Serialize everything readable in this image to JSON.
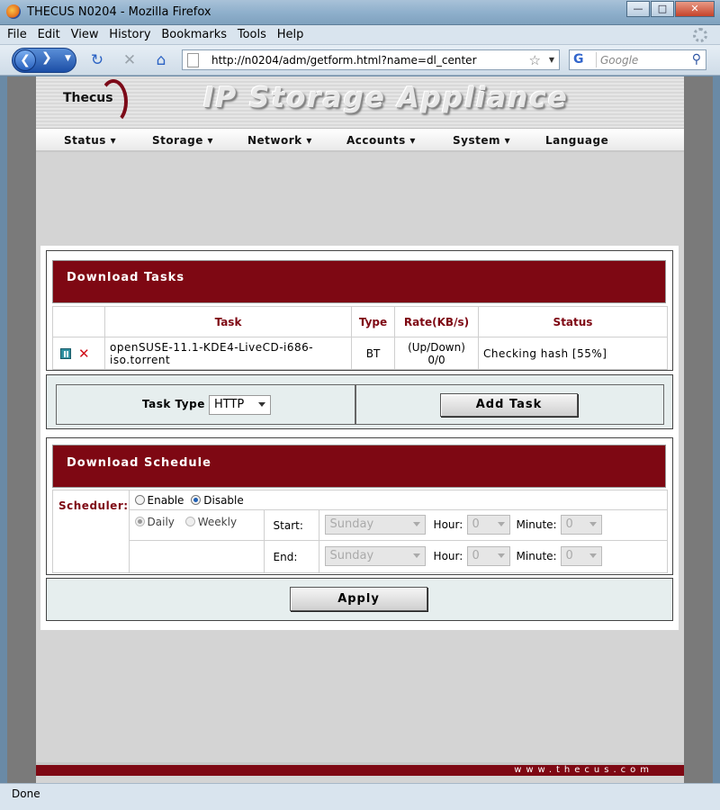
{
  "browser": {
    "window_title": "THECUS N0204 - Mozilla Firefox",
    "menu": [
      "File",
      "Edit",
      "View",
      "History",
      "Bookmarks",
      "Tools",
      "Help"
    ],
    "url": "http://n0204/adm/getform.html?name=dl_center",
    "search_placeholder": "Google",
    "status_text": "Done"
  },
  "site": {
    "logo": "Thecus",
    "banner_title": "IP Storage Appliance",
    "nav": [
      "Status",
      "Storage",
      "Network",
      "Accounts",
      "System",
      "Language"
    ],
    "footer_url": "www.thecus.com"
  },
  "download_tasks": {
    "heading": "Download Tasks",
    "columns": [
      "Task",
      "Type",
      "Rate(KB/s)",
      "Status"
    ],
    "rows": [
      {
        "task": "openSUSE-11.1-KDE4-LiveCD-i686-iso.torrent",
        "type": "BT",
        "rate_label": "(Up/Down)",
        "rate_value": "0/0",
        "status": "Checking hash [55%]"
      }
    ]
  },
  "add_task": {
    "task_type_label": "Task Type",
    "task_type_value": "HTTP",
    "add_button": "Add Task"
  },
  "schedule": {
    "heading": "Download Schedule",
    "scheduler_label": "Scheduler:",
    "enable_label": "Enable",
    "disable_label": "Disable",
    "daily_label": "Daily",
    "weekly_label": "Weekly",
    "start_label": "Start:",
    "end_label": "End:",
    "start_day": "Sunday",
    "end_day": "Sunday",
    "hour_label": "Hour:",
    "minute_label": "Minute:",
    "start_hour": "0",
    "start_minute": "0",
    "end_hour": "0",
    "end_minute": "0",
    "scheduler_state": "Disable",
    "frequency": "Daily"
  },
  "apply_button": "Apply",
  "colors": {
    "header_red": "#7e0813",
    "column_header_text": "#7e0813"
  }
}
